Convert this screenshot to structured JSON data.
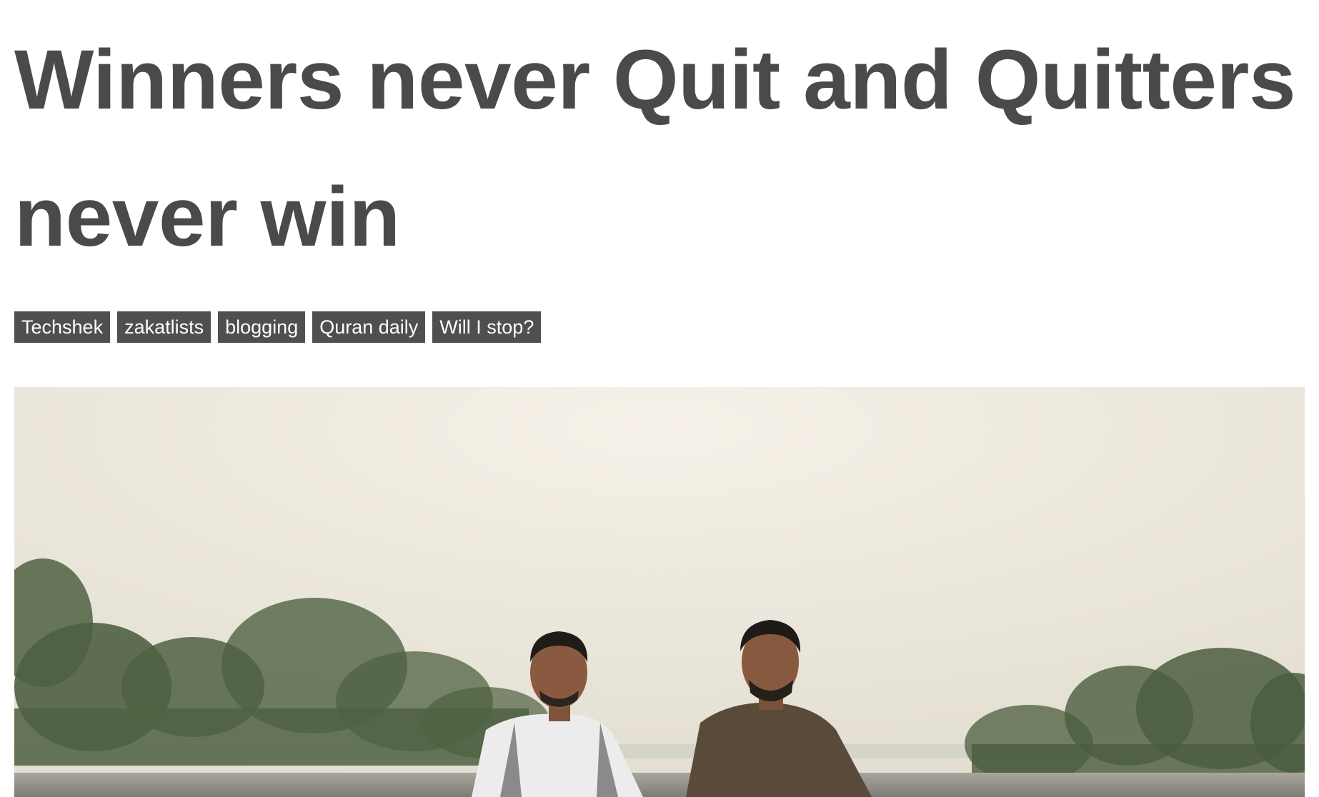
{
  "post": {
    "title": "Winners never Quit and Quitters never win"
  },
  "tags": [
    {
      "label": "Techshek"
    },
    {
      "label": "zakatlists"
    },
    {
      "label": "blogging"
    },
    {
      "label": "Quran daily"
    },
    {
      "label": "Will I stop?"
    }
  ],
  "featured_image": {
    "subject": "two men crouching on an empty road with trees in the background",
    "colors": {
      "sky_top": "#f3ede3",
      "sky_bottom": "#e4e0d4",
      "trees": "#4d5f3e",
      "road": "#8f8f88",
      "shirt_white": "#eeeeee",
      "kameez_brown": "#5a4a3a",
      "skin": "#8a5a40",
      "hair": "#1e1a18"
    }
  }
}
